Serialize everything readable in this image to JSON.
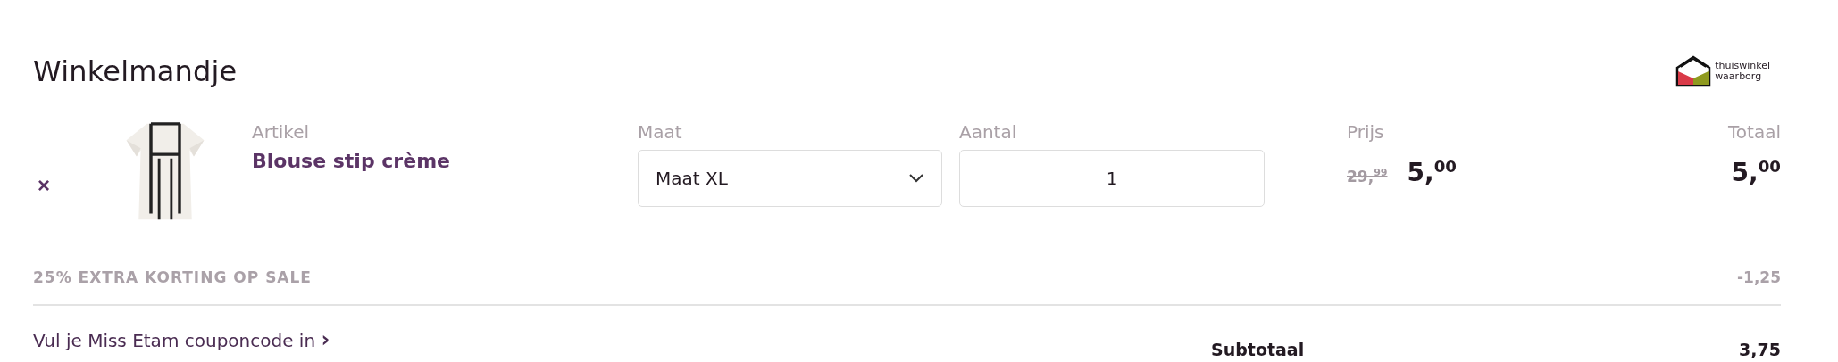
{
  "title": "Winkelmandje",
  "logo": {
    "lines": [
      "thuiswinkel",
      "waarborg"
    ]
  },
  "columns": {
    "article": "Artikel",
    "size": "Maat",
    "quantity": "Aantal",
    "price": "Prijs",
    "total": "Totaal"
  },
  "items": [
    {
      "remove": "×",
      "name": "Blouse stip crème",
      "size": "Maat XL",
      "quantity": "1",
      "old_price": "29,$^{99}$",
      "price": "5,$^{00}$",
      "total": "5,$^{00}$"
    }
  ],
  "discount": {
    "label": "25% EXTRA KORTING OP SALE",
    "amount": "-1,25"
  },
  "coupon": {
    "label": "Vul je Miss Etam couponcode in",
    "arrow": "›"
  },
  "subtotal": {
    "label": "Subtotaal",
    "amount": "3,75"
  }
}
